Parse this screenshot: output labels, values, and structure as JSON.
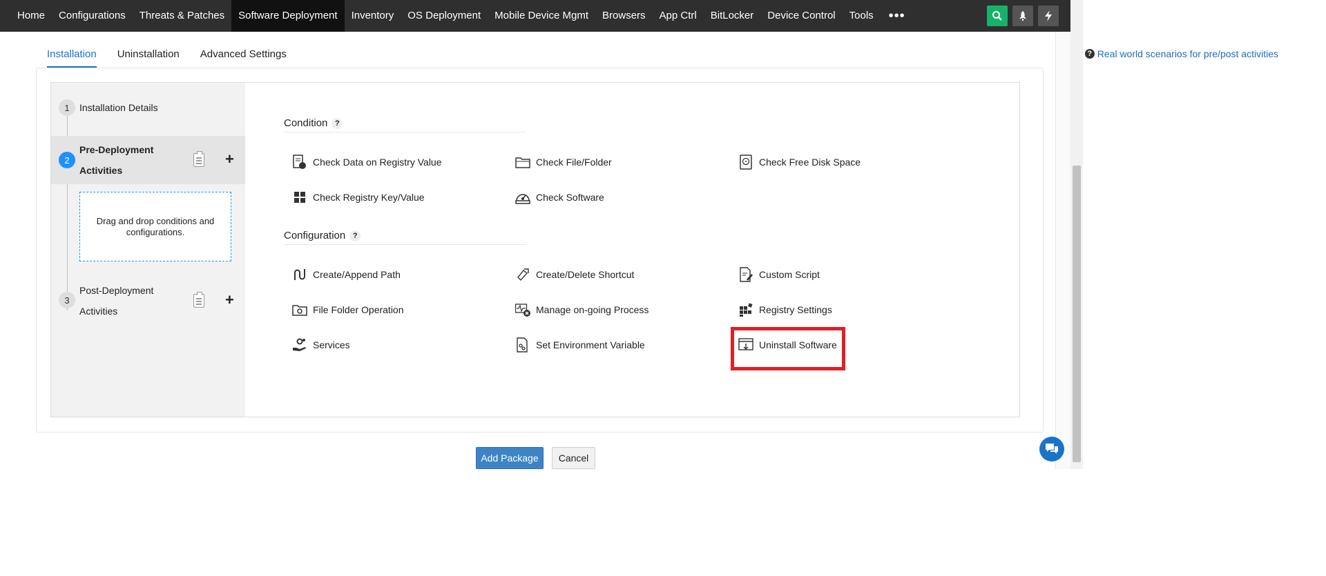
{
  "nav": {
    "items": [
      "Home",
      "Configurations",
      "Threats & Patches",
      "Software Deployment",
      "Inventory",
      "OS Deployment",
      "Mobile Device Mgmt",
      "Browsers",
      "App Ctrl",
      "BitLocker",
      "Device Control",
      "Tools"
    ],
    "active": "Software Deployment",
    "more_icon": "more-dots-icon",
    "icons": [
      "search-icon",
      "rocket-icon",
      "lightning-icon"
    ]
  },
  "tabs": {
    "items": [
      "Installation",
      "Uninstallation",
      "Advanced Settings"
    ],
    "active": "Installation"
  },
  "help_link": "Real world scenarios for pre/post activities",
  "steps": [
    {
      "num": "1",
      "label": "Installation Details"
    },
    {
      "num": "2",
      "label_line1": "Pre-Deployment",
      "label_line2": "Activities"
    },
    {
      "num": "3",
      "label_line1": "Post-Deployment",
      "label_line2": "Activities"
    }
  ],
  "dropzone_text": "Drag and drop conditions and configurations.",
  "condition": {
    "title": "Condition",
    "help": "?",
    "items": [
      "Check Data on Registry Value",
      "Check File/Folder",
      "Check Free Disk Space",
      "Check Registry Key/Value",
      "Check Software"
    ]
  },
  "configuration": {
    "title": "Configuration",
    "help": "?",
    "items": [
      "Create/Append Path",
      "Create/Delete Shortcut",
      "Custom Script",
      "File Folder Operation",
      "Manage on-going Process",
      "Registry Settings",
      "Services",
      "Set Environment Variable",
      "Uninstall Software"
    ]
  },
  "buttons": {
    "add": "Add Package",
    "cancel": "Cancel"
  },
  "colors": {
    "accent": "#1a73c8",
    "highlight": "#e01f26",
    "nav_bg": "#2f2f2f",
    "green": "#17b26a"
  }
}
